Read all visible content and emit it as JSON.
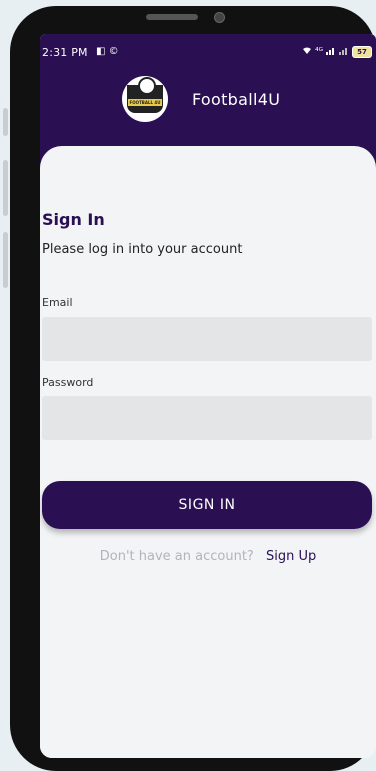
{
  "status_bar": {
    "time": "2:31 PM",
    "left_icons": "◧ ©",
    "network": "⁴ᴳ",
    "battery": "57"
  },
  "header": {
    "app_name": "Football4U",
    "logo_text": "FOOTBALL 4U"
  },
  "form": {
    "title": "Sign In",
    "subtitle": "Please log in into your account",
    "email_label": "Email",
    "email_value": "",
    "email_placeholder": "",
    "password_label": "Password",
    "password_value": "",
    "password_placeholder": "",
    "submit_label": "SIGN IN",
    "signup_prompt": "Don't have an account?",
    "signup_link": "Sign Up"
  },
  "colors": {
    "brand": "#2a0f53",
    "input_bg": "#e3e5e7",
    "muted_text": "#b1b4b8",
    "page_bg": "#f3f4f6"
  }
}
